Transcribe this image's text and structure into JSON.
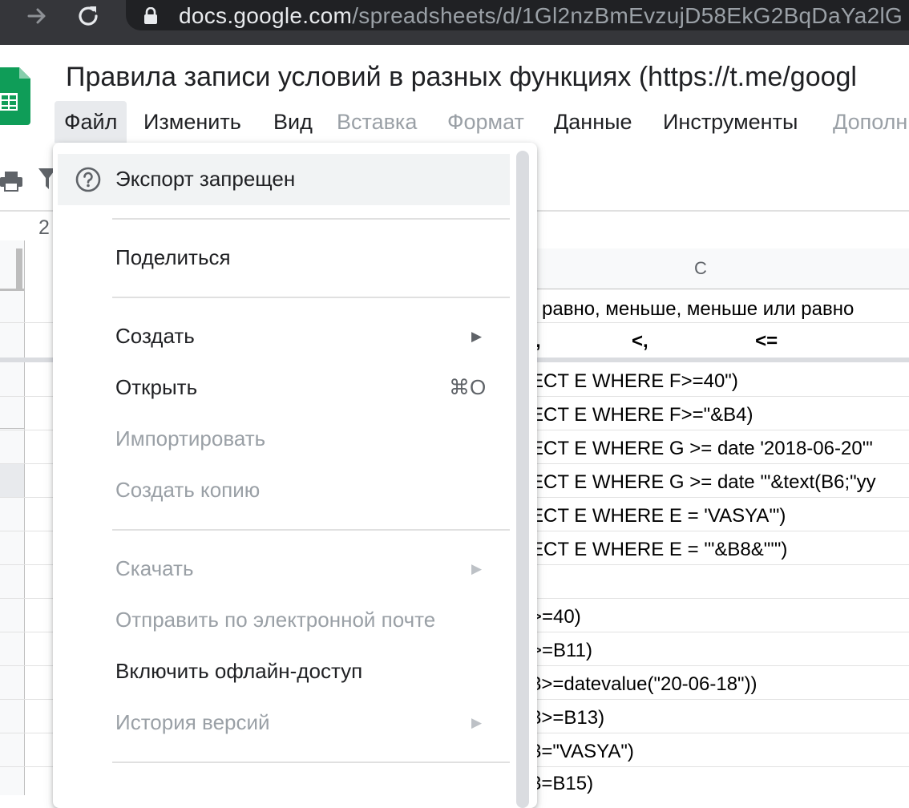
{
  "browser": {
    "url_host": "docs.google.com",
    "url_path": "/spreadsheets/d/1Gl2nzBmEvzujD58EkG2BqDaYa2lG"
  },
  "document": {
    "title": "Правила записи условий в разных функциях (https://t.me/googl"
  },
  "menubar": [
    {
      "label": "Файл",
      "state": "active"
    },
    {
      "label": "Изменить",
      "state": "enabled"
    },
    {
      "label": "Вид",
      "state": "enabled"
    },
    {
      "label": "Вставка",
      "state": "disabled"
    },
    {
      "label": "Формат",
      "state": "disabled"
    },
    {
      "label": "Данные",
      "state": "enabled"
    },
    {
      "label": "Инструменты",
      "state": "enabled"
    },
    {
      "label": "Дополн",
      "state": "disabled"
    }
  ],
  "formula_bar": {
    "cell_ref_fragment": "2"
  },
  "sheet": {
    "column_letter": "C",
    "cells": [
      {
        "text": "равно, меньше, меньше или равно",
        "bold": false
      },
      {
        "text": ",                 <,                    <=",
        "bold": true
      },
      {
        "text": "ECT E WHERE F>=40\")",
        "bold": false
      },
      {
        "text": "ECT E WHERE F>=\"&B4)",
        "bold": false
      },
      {
        "text": "ECT E WHERE G >= date '2018-06-20'\"",
        "bold": false
      },
      {
        "text": "ECT E WHERE G >= date '\"&text(B6;\"yy",
        "bold": false
      },
      {
        "text": "ECT E WHERE E = 'VASYA'\")",
        "bold": false
      },
      {
        "text": "ECT E WHERE E = '\"&B8&\"'\")",
        "bold": false
      },
      {
        "text": "",
        "bold": false
      },
      {
        "text": ">=40)",
        "bold": false
      },
      {
        "text": ">=B11)",
        "bold": false
      },
      {
        "text": "3>=datevalue(\"20-06-18\"))",
        "bold": false
      },
      {
        "text": "3>=B13)",
        "bold": false
      },
      {
        "text": "3=\"VASYA\")",
        "bold": false
      },
      {
        "text": "3=B15)",
        "bold": false
      }
    ]
  },
  "file_menu": {
    "export_disabled": "Экспорт запрещен",
    "share": "Поделиться",
    "create": "Создать",
    "open": "Открыть",
    "open_shortcut": "⌘O",
    "import": "Импортировать",
    "make_copy": "Создать копию",
    "download": "Скачать",
    "email": "Отправить по электронной почте",
    "offline": "Включить офлайн-доступ",
    "version_history": "История версий",
    "submenu_arrow": "▶"
  },
  "colors": {
    "browser_bar": "#35363a",
    "omnibox": "#202124",
    "menu_disabled": "#9aa0a6",
    "sheets_green": "#0f9d58"
  },
  "icons": {
    "back": "arrow-right-icon",
    "reload": "reload-icon",
    "lock": "lock-icon",
    "logo": "google-sheets-logo-icon",
    "help": "help-circle-icon",
    "print": "print-icon",
    "filter": "filter-icon"
  }
}
